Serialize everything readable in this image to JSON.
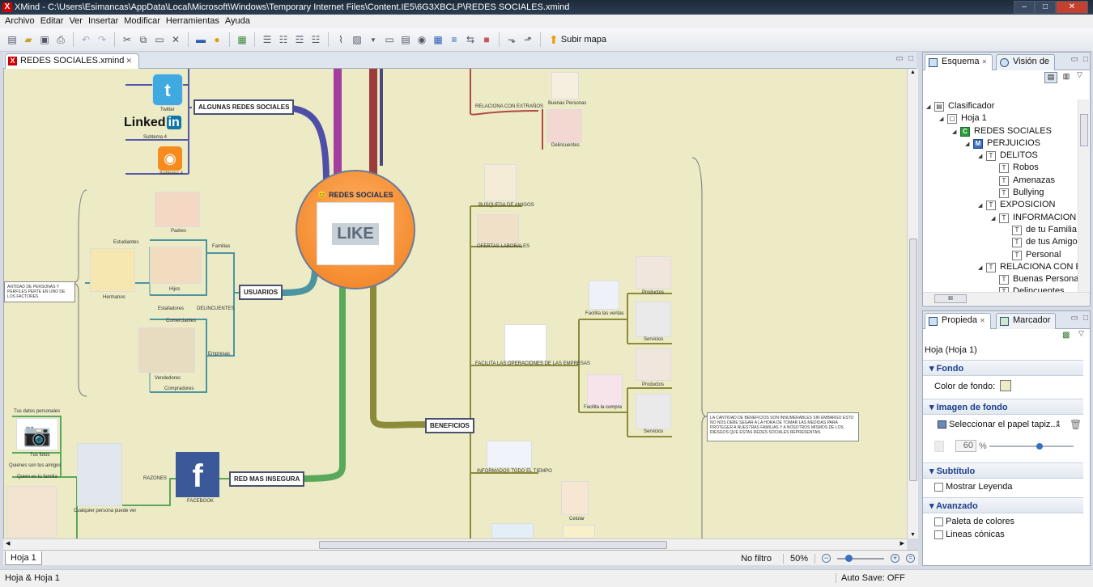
{
  "window": {
    "title": "XMind - C:\\Users\\Esimancas\\AppData\\Local\\Microsoft\\Windows\\Temporary Internet Files\\Content.IE5\\6G3XBCLP\\REDES SOCIALES.xmind",
    "app_icon": "X",
    "minimize": "–",
    "maximize": "□",
    "close": "✕"
  },
  "menu": [
    "Archivo",
    "Editar",
    "Ver",
    "Insertar",
    "Modificar",
    "Herramientas",
    "Ayuda"
  ],
  "toolbar": {
    "upload_label": "Subir mapa"
  },
  "editor": {
    "tab_label": "REDES SOCIALES.xmind",
    "tab_close": "✕"
  },
  "mindmap": {
    "central": "REDES SOCIALES",
    "central_image_text": "LIKE",
    "topics": {
      "algunas": "ALGUNAS REDES SOCIALES",
      "usuarios": "USUARIOS",
      "red_insegura": "RED MAS INSEGURA",
      "beneficios": "BENEFICIOS"
    },
    "labels": {
      "twitter": "Twitter",
      "linkedin_logo": "Linked",
      "linkedin_in": "in",
      "subtema4a": "Subtema 4",
      "subtema4b": "Subtema 4",
      "padres": "Padres",
      "estudiantes": "Estudiantes",
      "familias": "Familias",
      "hijos": "Hijos",
      "hermanos": "Hermanos",
      "estafadores": "Estafadores",
      "delincuentes_u": "DELINCUENTES",
      "comerciantes": "Comerciantes",
      "empresas": "Empresas",
      "vendedores": "Vendedores",
      "compradores": "Compradores",
      "usuarios_note": "ANTIDAD DE PERSONAS Y PERFILES PERTE EN UNO DE LOS FACTORES",
      "tus_datos": "Tus datos personales",
      "tus_fotos": "Tus fotos",
      "quienes": "Quienes son tus amigos",
      "quien_familia": "Quien es tu familia",
      "cualquier": "Cualquier persona puede ver",
      "razones": "RAZONES",
      "facebook": "FACEBOOK",
      "relaciona": "RELACIONA CON EXTRAÑOS",
      "buenas": "Buenas Personas",
      "delincuentes": "Delincuentes",
      "busqueda": "BUSQUEDA DE AMIGOS",
      "ofertas": "OFERTAS LABORALES",
      "facilita_op": "FACILITA LAS OPERACIONES DE LAS EMPRESAS",
      "facilita_ventas": "Facilita las ventas",
      "productos1": "Productos",
      "servicios1": "Servicios",
      "facilita_compra": "Facilita la compra",
      "productos2": "Productos",
      "servicios2": "Servicios",
      "informados": "INFORMADOS TODO EL TIEMPO",
      "celular": "Celular",
      "beneficios_note": "LA CANTIDAD DE BENEFICIOS SON INNUMERABLES SIN EMBARGO ESTO NO NOS DEBE SEGAR A LA HORA DE TOMAR LAS MEDIDAS PARA PROTEGER A NUESTRAS FAMILIAS Y A NOSOTROS MISMOS DE LOS RIESGOS QUE ESTAS REDES SOCIALES REPRESENTAN."
    }
  },
  "sheetbar": {
    "sheet": "Hoja 1",
    "filter": "No filtro",
    "zoom": "50%"
  },
  "status": {
    "left": "Hoja & Hoja 1",
    "autosave": "Auto Save: OFF"
  },
  "outline": {
    "tab1": "Esquema",
    "tab2": "Visión de",
    "nodes": [
      {
        "label": "Clasificador",
        "level": 0,
        "icon": "C"
      },
      {
        "label": "Hoja 1",
        "level": 1,
        "icon": "S"
      },
      {
        "label": "REDES SOCIALES",
        "level": 2,
        "icon": "C"
      },
      {
        "label": "PERJUICIOS",
        "level": 3,
        "icon": "M"
      },
      {
        "label": "DELITOS",
        "level": 4,
        "icon": "T"
      },
      {
        "label": "Robos",
        "level": 5,
        "icon": "T"
      },
      {
        "label": "Amenazas",
        "level": 5,
        "icon": "T"
      },
      {
        "label": "Bullying",
        "level": 5,
        "icon": "T"
      },
      {
        "label": "EXPOSICION",
        "level": 4,
        "icon": "T"
      },
      {
        "label": "INFORMACION",
        "level": 5,
        "icon": "T"
      },
      {
        "label": "de tu Familia",
        "level": 6,
        "icon": "T"
      },
      {
        "label": "de tus Amigo",
        "level": 6,
        "icon": "T"
      },
      {
        "label": "Personal",
        "level": 6,
        "icon": "T"
      },
      {
        "label": "RELACIONA CON E",
        "level": 4,
        "icon": "T"
      },
      {
        "label": "Buenas Personas",
        "level": 5,
        "icon": "T"
      },
      {
        "label": "Delincuentes",
        "level": 5,
        "icon": "T"
      }
    ],
    "scroll_label": "III"
  },
  "properties": {
    "tab1": "Propieda",
    "tab2": "Marcador",
    "title": "Hoja (Hoja 1)",
    "sections": {
      "fondo": "Fondo",
      "color_fondo": "Color de fondo:",
      "color_value": "#ecebc6",
      "imagen": "Imagen de fondo",
      "seleccionar": "Seleccionar el papel tapiz....",
      "opacity": "60",
      "percent": "%",
      "subtitulo": "Subtítulo",
      "mostrar_leyenda": "Mostrar Leyenda",
      "avanzado": "Avanzado",
      "paleta": "Paleta de colores",
      "lineas": "Lineas cónicas"
    }
  }
}
